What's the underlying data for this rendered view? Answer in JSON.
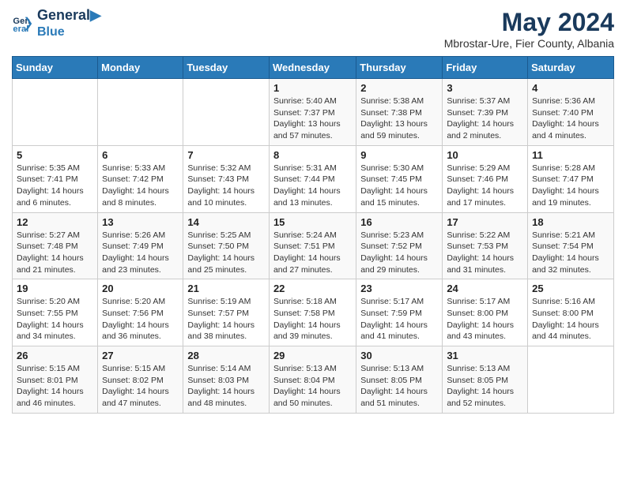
{
  "header": {
    "logo_line1": "General",
    "logo_line2": "Blue",
    "title": "May 2024",
    "subtitle": "Mbrostar-Ure, Fier County, Albania"
  },
  "days_of_week": [
    "Sunday",
    "Monday",
    "Tuesday",
    "Wednesday",
    "Thursday",
    "Friday",
    "Saturday"
  ],
  "weeks": [
    [
      {
        "num": "",
        "sunrise": "",
        "sunset": "",
        "daylight": ""
      },
      {
        "num": "",
        "sunrise": "",
        "sunset": "",
        "daylight": ""
      },
      {
        "num": "",
        "sunrise": "",
        "sunset": "",
        "daylight": ""
      },
      {
        "num": "1",
        "sunrise": "Sunrise: 5:40 AM",
        "sunset": "Sunset: 7:37 PM",
        "daylight": "Daylight: 13 hours and 57 minutes."
      },
      {
        "num": "2",
        "sunrise": "Sunrise: 5:38 AM",
        "sunset": "Sunset: 7:38 PM",
        "daylight": "Daylight: 13 hours and 59 minutes."
      },
      {
        "num": "3",
        "sunrise": "Sunrise: 5:37 AM",
        "sunset": "Sunset: 7:39 PM",
        "daylight": "Daylight: 14 hours and 2 minutes."
      },
      {
        "num": "4",
        "sunrise": "Sunrise: 5:36 AM",
        "sunset": "Sunset: 7:40 PM",
        "daylight": "Daylight: 14 hours and 4 minutes."
      }
    ],
    [
      {
        "num": "5",
        "sunrise": "Sunrise: 5:35 AM",
        "sunset": "Sunset: 7:41 PM",
        "daylight": "Daylight: 14 hours and 6 minutes."
      },
      {
        "num": "6",
        "sunrise": "Sunrise: 5:33 AM",
        "sunset": "Sunset: 7:42 PM",
        "daylight": "Daylight: 14 hours and 8 minutes."
      },
      {
        "num": "7",
        "sunrise": "Sunrise: 5:32 AM",
        "sunset": "Sunset: 7:43 PM",
        "daylight": "Daylight: 14 hours and 10 minutes."
      },
      {
        "num": "8",
        "sunrise": "Sunrise: 5:31 AM",
        "sunset": "Sunset: 7:44 PM",
        "daylight": "Daylight: 14 hours and 13 minutes."
      },
      {
        "num": "9",
        "sunrise": "Sunrise: 5:30 AM",
        "sunset": "Sunset: 7:45 PM",
        "daylight": "Daylight: 14 hours and 15 minutes."
      },
      {
        "num": "10",
        "sunrise": "Sunrise: 5:29 AM",
        "sunset": "Sunset: 7:46 PM",
        "daylight": "Daylight: 14 hours and 17 minutes."
      },
      {
        "num": "11",
        "sunrise": "Sunrise: 5:28 AM",
        "sunset": "Sunset: 7:47 PM",
        "daylight": "Daylight: 14 hours and 19 minutes."
      }
    ],
    [
      {
        "num": "12",
        "sunrise": "Sunrise: 5:27 AM",
        "sunset": "Sunset: 7:48 PM",
        "daylight": "Daylight: 14 hours and 21 minutes."
      },
      {
        "num": "13",
        "sunrise": "Sunrise: 5:26 AM",
        "sunset": "Sunset: 7:49 PM",
        "daylight": "Daylight: 14 hours and 23 minutes."
      },
      {
        "num": "14",
        "sunrise": "Sunrise: 5:25 AM",
        "sunset": "Sunset: 7:50 PM",
        "daylight": "Daylight: 14 hours and 25 minutes."
      },
      {
        "num": "15",
        "sunrise": "Sunrise: 5:24 AM",
        "sunset": "Sunset: 7:51 PM",
        "daylight": "Daylight: 14 hours and 27 minutes."
      },
      {
        "num": "16",
        "sunrise": "Sunrise: 5:23 AM",
        "sunset": "Sunset: 7:52 PM",
        "daylight": "Daylight: 14 hours and 29 minutes."
      },
      {
        "num": "17",
        "sunrise": "Sunrise: 5:22 AM",
        "sunset": "Sunset: 7:53 PM",
        "daylight": "Daylight: 14 hours and 31 minutes."
      },
      {
        "num": "18",
        "sunrise": "Sunrise: 5:21 AM",
        "sunset": "Sunset: 7:54 PM",
        "daylight": "Daylight: 14 hours and 32 minutes."
      }
    ],
    [
      {
        "num": "19",
        "sunrise": "Sunrise: 5:20 AM",
        "sunset": "Sunset: 7:55 PM",
        "daylight": "Daylight: 14 hours and 34 minutes."
      },
      {
        "num": "20",
        "sunrise": "Sunrise: 5:20 AM",
        "sunset": "Sunset: 7:56 PM",
        "daylight": "Daylight: 14 hours and 36 minutes."
      },
      {
        "num": "21",
        "sunrise": "Sunrise: 5:19 AM",
        "sunset": "Sunset: 7:57 PM",
        "daylight": "Daylight: 14 hours and 38 minutes."
      },
      {
        "num": "22",
        "sunrise": "Sunrise: 5:18 AM",
        "sunset": "Sunset: 7:58 PM",
        "daylight": "Daylight: 14 hours and 39 minutes."
      },
      {
        "num": "23",
        "sunrise": "Sunrise: 5:17 AM",
        "sunset": "Sunset: 7:59 PM",
        "daylight": "Daylight: 14 hours and 41 minutes."
      },
      {
        "num": "24",
        "sunrise": "Sunrise: 5:17 AM",
        "sunset": "Sunset: 8:00 PM",
        "daylight": "Daylight: 14 hours and 43 minutes."
      },
      {
        "num": "25",
        "sunrise": "Sunrise: 5:16 AM",
        "sunset": "Sunset: 8:00 PM",
        "daylight": "Daylight: 14 hours and 44 minutes."
      }
    ],
    [
      {
        "num": "26",
        "sunrise": "Sunrise: 5:15 AM",
        "sunset": "Sunset: 8:01 PM",
        "daylight": "Daylight: 14 hours and 46 minutes."
      },
      {
        "num": "27",
        "sunrise": "Sunrise: 5:15 AM",
        "sunset": "Sunset: 8:02 PM",
        "daylight": "Daylight: 14 hours and 47 minutes."
      },
      {
        "num": "28",
        "sunrise": "Sunrise: 5:14 AM",
        "sunset": "Sunset: 8:03 PM",
        "daylight": "Daylight: 14 hours and 48 minutes."
      },
      {
        "num": "29",
        "sunrise": "Sunrise: 5:13 AM",
        "sunset": "Sunset: 8:04 PM",
        "daylight": "Daylight: 14 hours and 50 minutes."
      },
      {
        "num": "30",
        "sunrise": "Sunrise: 5:13 AM",
        "sunset": "Sunset: 8:05 PM",
        "daylight": "Daylight: 14 hours and 51 minutes."
      },
      {
        "num": "31",
        "sunrise": "Sunrise: 5:13 AM",
        "sunset": "Sunset: 8:05 PM",
        "daylight": "Daylight: 14 hours and 52 minutes."
      },
      {
        "num": "",
        "sunrise": "",
        "sunset": "",
        "daylight": ""
      }
    ]
  ]
}
